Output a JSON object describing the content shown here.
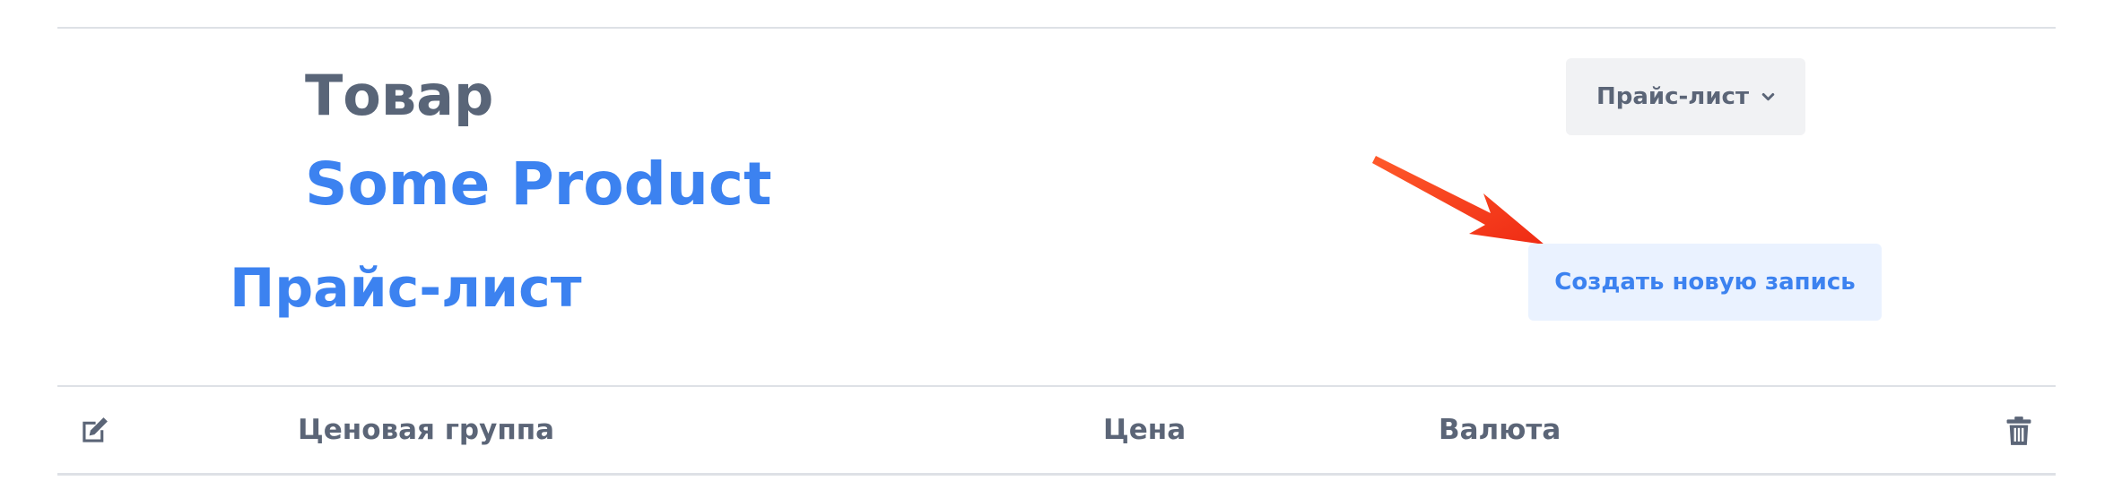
{
  "header": {
    "entity_label": "Товар",
    "entity_name": "Some Product",
    "section_title": "Прайс-лист"
  },
  "toolbar": {
    "dropdown_label": "Прайс-лист",
    "create_label": "Создать новую запись"
  },
  "table": {
    "columns": [
      "Ценовая группа",
      "Цена",
      "Валюта"
    ]
  },
  "icons": {
    "edit": "edit-icon",
    "delete": "trash-icon",
    "dropdown": "chevron-down-icon"
  },
  "colors": {
    "accent": "#3c82f0",
    "text": "#5b6577",
    "annotation_arrow": "#f43a1e"
  }
}
